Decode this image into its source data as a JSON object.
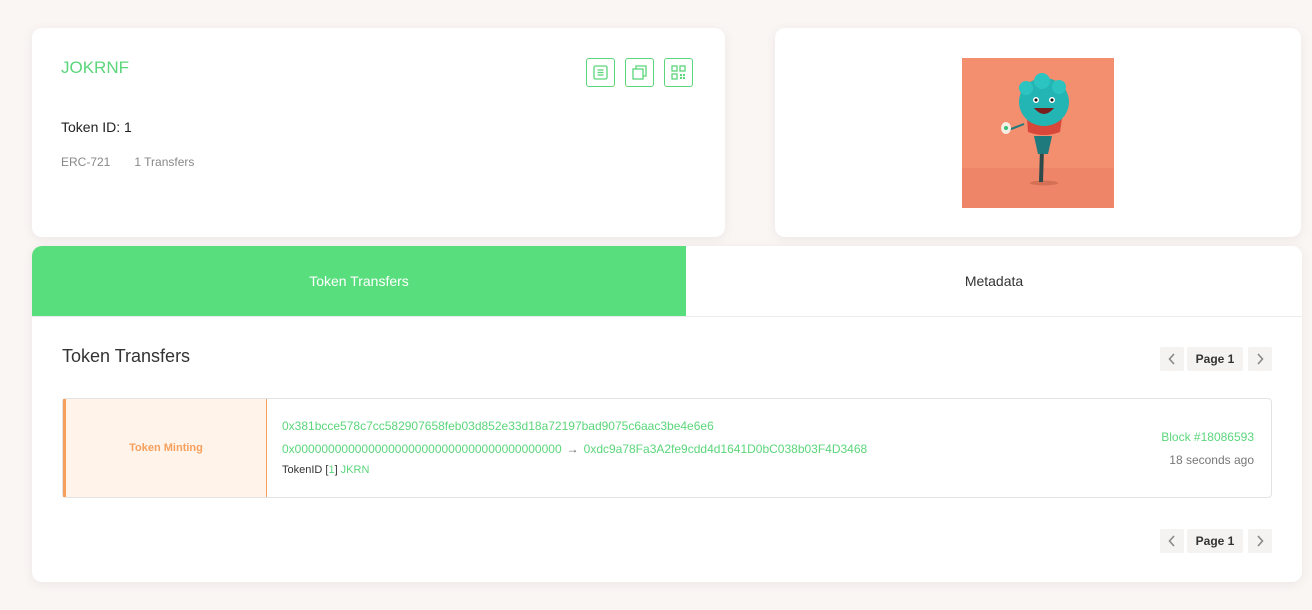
{
  "token": {
    "name": "JOKRNF",
    "token_id_label": "Token ID: 1",
    "standard": "ERC-721",
    "transfers": "1 Transfers",
    "actions": [
      "metadata-icon",
      "copy-icon",
      "qr-code-icon"
    ]
  },
  "image": {
    "alt": "NFT artwork"
  },
  "tabs": [
    {
      "label": "Token Transfers",
      "active": true
    },
    {
      "label": "Metadata",
      "active": false
    }
  ],
  "section": {
    "title": "Token Transfers"
  },
  "pagination": {
    "page_label": "Page 1",
    "prev_icon": "chevron-left-icon",
    "next_icon": "chevron-right-icon"
  },
  "transfer": {
    "type": "Token Minting",
    "tx_hash": "0x381bcce578c7cc582907658feb03d852e33d18a72197bad9075c6aac3be4e6e6",
    "from": "0x0000000000000000000000000000000000000000",
    "arrow": "→",
    "to": "0xdc9a78Fa3A2fe9cdd4d1641D0bC038b03F4D3468",
    "token_label": "TokenID",
    "bracket_open": "[",
    "token_id": "1",
    "bracket_close": "]",
    "symbol": "JKRN",
    "block": "Block #18086593",
    "age": "18 seconds ago"
  },
  "colors": {
    "accent": "#59de7e",
    "accent_text": "#5bd67b",
    "minting": "#f7a05d",
    "minting_bg": "#fff3ea",
    "page_bg": "#faf6f3"
  }
}
